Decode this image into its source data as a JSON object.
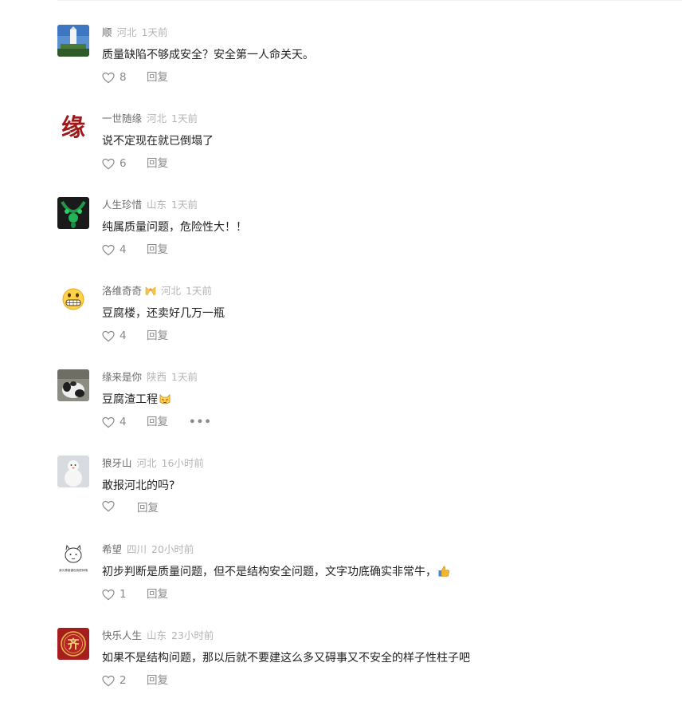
{
  "comments": [
    {
      "name": "顺",
      "location": "河北",
      "time": "1天前",
      "text": "质量缺陷不够成安全？安全第一人命关天。",
      "likes": "8",
      "reply": "回复",
      "avatar": "landscape-photo-avatar"
    },
    {
      "name": "一世随缘",
      "location": "河北",
      "time": "1天前",
      "text": "说不定现在就已倒塌了",
      "likes": "6",
      "reply": "回复",
      "avatar": "calligraphy-avatar",
      "avatar_text": "缘"
    },
    {
      "name": "人生珍惜",
      "location": "山东",
      "time": "1天前",
      "text": "纯属质量问题，危险性大！！",
      "likes": "4",
      "reply": "回复",
      "avatar": "jade-necklace-avatar"
    },
    {
      "name": "洛维奇奇",
      "location": "河北",
      "time": "1天前",
      "text": "豆腐楼，还卖好几万一瓶",
      "likes": "4",
      "reply": "回复",
      "avatar": "grin-emoji-avatar",
      "badge": "ribbon-badge-icon"
    },
    {
      "name": "缘来是你",
      "location": "陕西",
      "time": "1天前",
      "text": "豆腐渣工程",
      "likes": "4",
      "reply": "回复",
      "more": "•••",
      "avatar": "panda-photo-avatar",
      "emoji": "cat-face-emoji"
    },
    {
      "name": "狼牙山",
      "location": "河北",
      "time": "16小时前",
      "text": "敢报河北的吗?",
      "likes": "",
      "reply": "回复",
      "avatar": "snowman-photo-avatar"
    },
    {
      "name": "希望",
      "location": "四川",
      "time": "20小时前",
      "text": "初步判断是质量问题，但不是结构安全问题，文字功底确实非常牛，",
      "likes": "1",
      "reply": "回复",
      "avatar": "cartoon-sketch-avatar",
      "avatar_text": "我头像普通但我很帅哦",
      "emoji": "thumbs-up-emoji"
    },
    {
      "name": "快乐人生",
      "location": "山东",
      "time": "23小时前",
      "text": "如果不是结构问题，那以后就不要建这么多又碍事又不安全的样子性柱子吧",
      "likes": "2",
      "reply": "回复",
      "avatar": "red-seal-avatar",
      "avatar_text": "齐"
    }
  ],
  "colors": {
    "name": "#6b6b6b",
    "meta": "#b4b4b4",
    "text": "#222222",
    "action": "#8a8a8a"
  }
}
